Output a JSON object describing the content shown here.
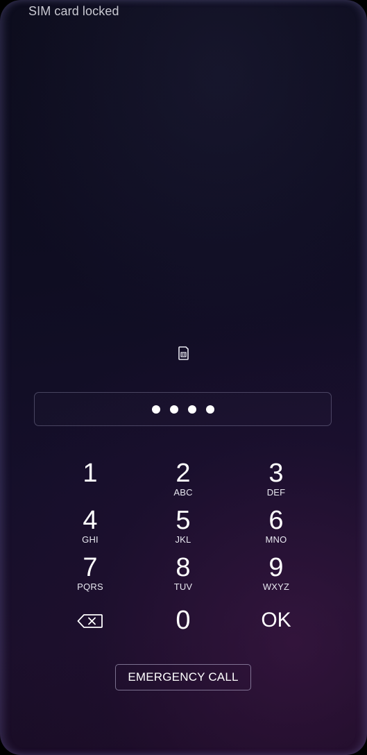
{
  "status_bar": {
    "carrier_text": "SIM card locked"
  },
  "lock": {
    "icon": "sim-card-icon",
    "pin_length_entered": 4
  },
  "keypad": {
    "keys": [
      {
        "digit": "1",
        "letters": ""
      },
      {
        "digit": "2",
        "letters": "ABC"
      },
      {
        "digit": "3",
        "letters": "DEF"
      },
      {
        "digit": "4",
        "letters": "GHI"
      },
      {
        "digit": "5",
        "letters": "JKL"
      },
      {
        "digit": "6",
        "letters": "MNO"
      },
      {
        "digit": "7",
        "letters": "PQRS"
      },
      {
        "digit": "8",
        "letters": "TUV"
      },
      {
        "digit": "9",
        "letters": "WXYZ"
      }
    ],
    "backspace_icon": "backspace-icon",
    "zero": "0",
    "ok_label": "OK"
  },
  "emergency_call_label": "EMERGENCY CALL",
  "colors": {
    "text": "#ffffff",
    "background_top": "#0c0c1c",
    "background_bottom": "#180b22"
  }
}
